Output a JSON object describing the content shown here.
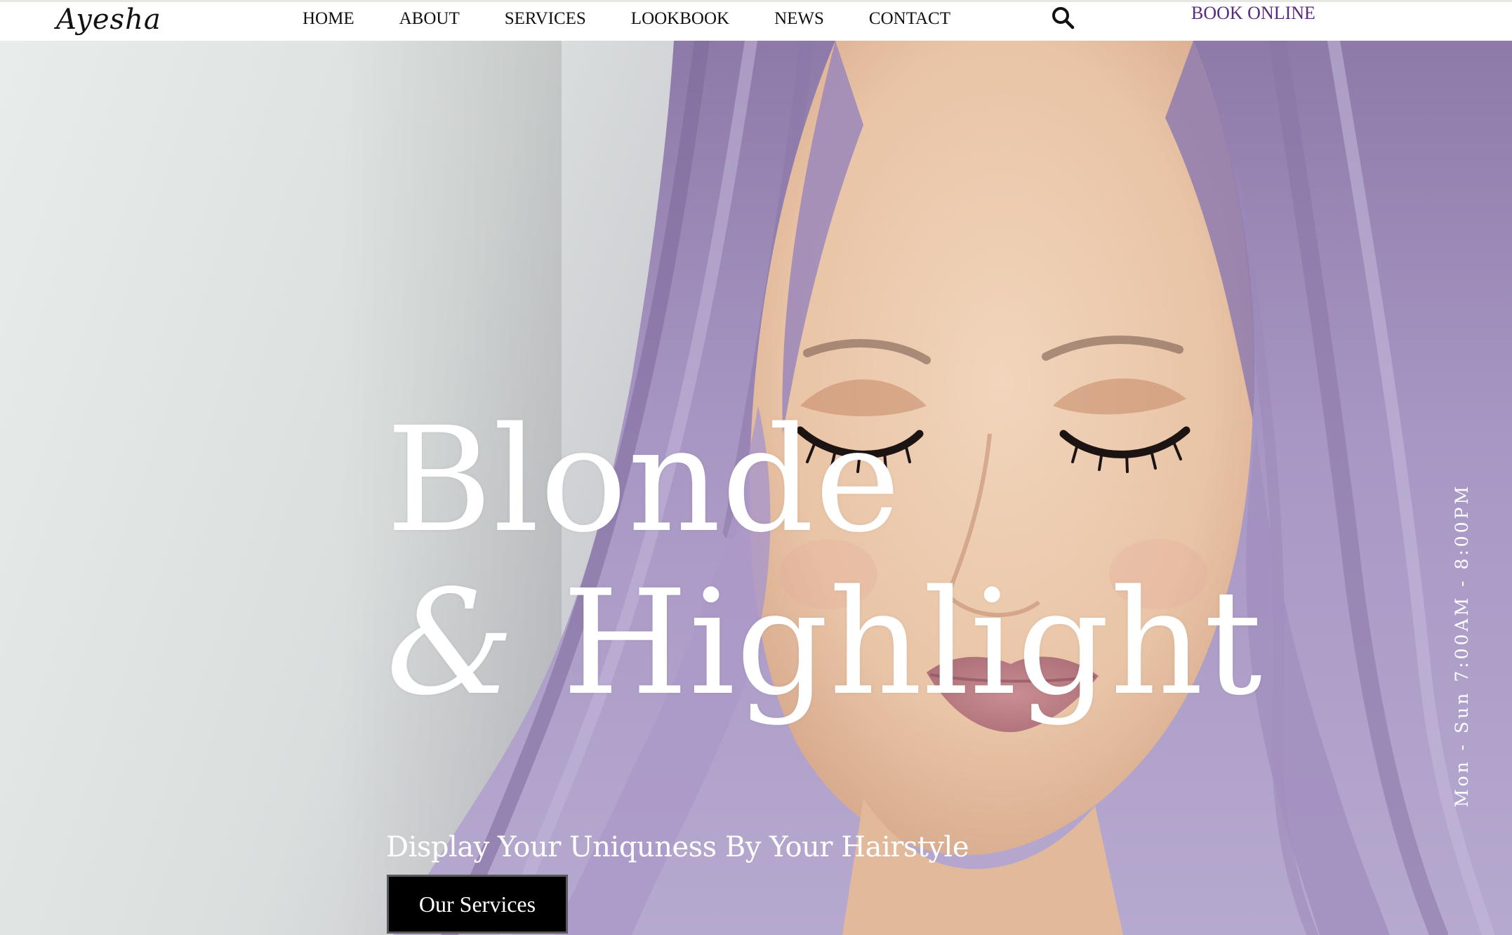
{
  "header": {
    "logo": "Ayesha",
    "nav": [
      {
        "label": "HOME"
      },
      {
        "label": "ABOUT"
      },
      {
        "label": "SERVICES"
      },
      {
        "label": "LOOKBOOK"
      },
      {
        "label": "NEWS"
      },
      {
        "label": "CONTACT"
      }
    ],
    "search_icon": "search-icon",
    "book_label": "BOOK ONLINE"
  },
  "hero": {
    "headline_line1": "Blonde",
    "headline_amp": "&",
    "headline_line2": "Highlight",
    "tagline": "Display Your Uniquness By Your Hairstyle",
    "cta_label": "Our Services",
    "hours": "Mon - Sun 7:00AM - 8:00PM",
    "image": "portrait-woman-lavender-hair"
  },
  "colors": {
    "accent": "#5a2a82",
    "hair": "#a58fc0",
    "text_dark": "#111111",
    "cta_bg": "#000000"
  }
}
